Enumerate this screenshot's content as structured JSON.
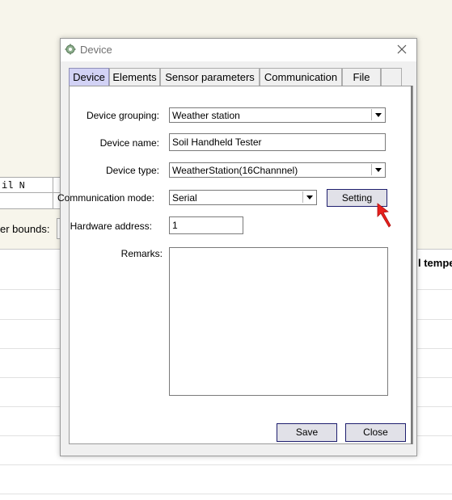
{
  "background": {
    "cell_header": "il N",
    "bounds_label": "er bounds:",
    "right_header": "l tempe"
  },
  "dialog": {
    "title": "Device",
    "tabs": [
      {
        "label": "Device",
        "active": true
      },
      {
        "label": "Elements",
        "active": false
      },
      {
        "label": "Sensor parameters",
        "active": false
      },
      {
        "label": "Communication",
        "active": false
      },
      {
        "label": "File",
        "active": false
      }
    ],
    "form": {
      "device_grouping_label": "Device grouping:",
      "device_grouping_value": "Weather station",
      "device_name_label": "Device name:",
      "device_name_value": "Soil Handheld Tester",
      "device_type_label": "Device type:",
      "device_type_value": "WeatherStation(16Channnel)",
      "comm_mode_label": "Communication mode:",
      "comm_mode_value": "Serial",
      "setting_button": "Setting",
      "hardware_address_label": "Hardware address:",
      "hardware_address_value": "1",
      "remarks_label": "Remarks:",
      "remarks_value": ""
    },
    "buttons": {
      "save": "Save",
      "close": "Close"
    }
  },
  "colors": {
    "active_tab": "#d2d2f5",
    "button_border": "#1e1e6e",
    "cursor_arrow": "#e8201c",
    "background_app": "#f7f5eb"
  }
}
